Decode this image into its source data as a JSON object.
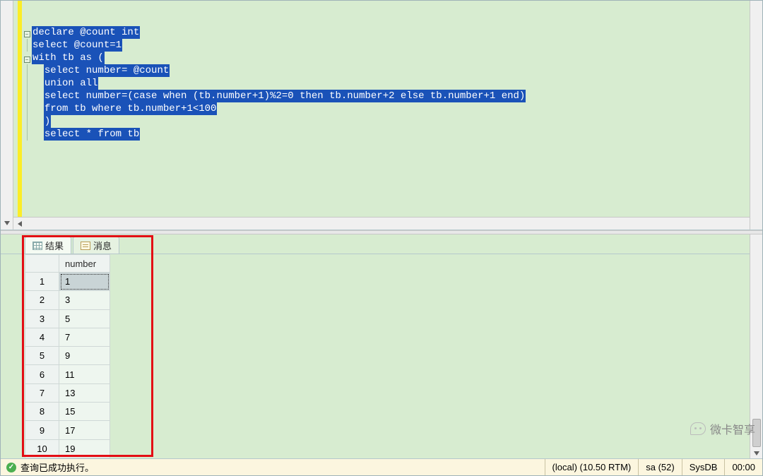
{
  "editor": {
    "lines": [
      {
        "indent": "",
        "text": "declare @count int"
      },
      {
        "indent": "",
        "text": "select @count=1"
      },
      {
        "indent": "",
        "text": "with tb as ("
      },
      {
        "indent": "  ",
        "text": "select number= @count"
      },
      {
        "indent": "  ",
        "text": "union all"
      },
      {
        "indent": "  ",
        "text": "select number=(case when (tb.number+1)%2=0 then tb.number+2 else tb.number+1 end)"
      },
      {
        "indent": "  ",
        "text": "from tb where tb.number+1<100"
      },
      {
        "indent": "  ",
        "text": ")"
      },
      {
        "indent": "  ",
        "text": "select * from tb"
      }
    ],
    "fold_markers": [
      "-",
      "",
      "-",
      "",
      "",
      "",
      "",
      "",
      ""
    ]
  },
  "tabs": {
    "results": "结果",
    "messages": "消息"
  },
  "grid": {
    "column": "number",
    "rows": [
      {
        "idx": "1",
        "val": "1"
      },
      {
        "idx": "2",
        "val": "3"
      },
      {
        "idx": "3",
        "val": "5"
      },
      {
        "idx": "4",
        "val": "7"
      },
      {
        "idx": "5",
        "val": "9"
      },
      {
        "idx": "6",
        "val": "11"
      },
      {
        "idx": "7",
        "val": "13"
      },
      {
        "idx": "8",
        "val": "15"
      },
      {
        "idx": "9",
        "val": "17"
      },
      {
        "idx": "10",
        "val": "19"
      }
    ]
  },
  "status": {
    "message": "查询已成功执行。",
    "server": "(local) (10.50 RTM)",
    "user": "sa (52)",
    "db": "SysDB",
    "time": "00:00"
  },
  "watermark": "微卡智享"
}
